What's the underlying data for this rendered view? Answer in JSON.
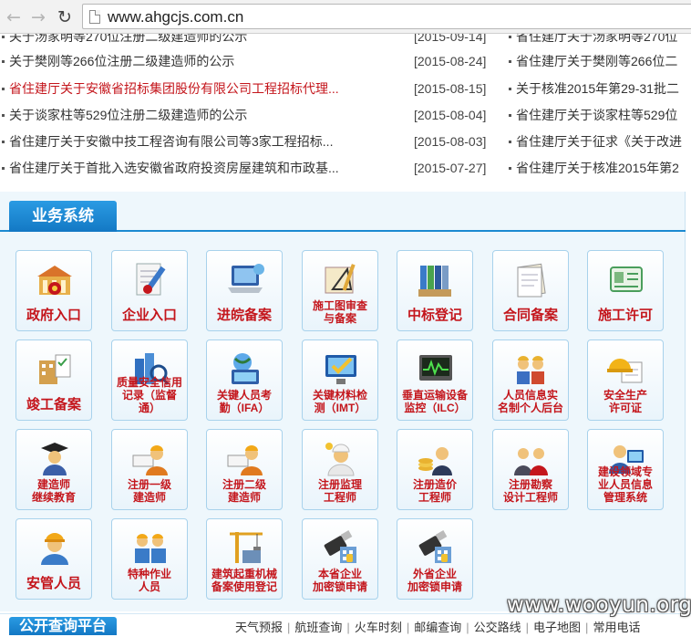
{
  "browser": {
    "url": "www.ahgcjs.com.cn",
    "back_icon": "arrow-left-icon",
    "forward_icon": "arrow-right-icon",
    "reload_icon": "reload-icon"
  },
  "news": {
    "rows": [
      {
        "title": "关于汤家明等270位注册二级建造师的公示",
        "date": "[2015-09-14]",
        "right": "省住建厅关于汤家明等270位"
      },
      {
        "title": "关于樊刚等266位注册二级建造师的公示",
        "date": "[2015-08-24]",
        "right": "省住建厅关于樊刚等266位二"
      },
      {
        "title": "省住建厅关于安徽省招标集团股份有限公司工程招标代理...",
        "date": "[2015-08-15]",
        "right": "关于核准2015年第29-31批二"
      },
      {
        "title": "关于谈家柱等529位注册二级建造师的公示",
        "date": "[2015-08-04]",
        "right": "省住建厅关于谈家柱等529位"
      },
      {
        "title": "省住建厅关于安徽中技工程咨询有限公司等3家工程招标...",
        "date": "[2015-08-03]",
        "right": "省住建厅关于征求《关于改进"
      },
      {
        "title": "省住建厅关于首批入选安徽省政府投资房屋建筑和市政基...",
        "date": "[2015-07-27]",
        "right": "省住建厅关于核准2015年第2"
      }
    ]
  },
  "business": {
    "title": "业务系统",
    "tiles": [
      {
        "lines": [
          "政府入口"
        ],
        "icon": "government-building-icon"
      },
      {
        "lines": [
          "企业入口"
        ],
        "icon": "document-pen-icon"
      },
      {
        "lines": [
          "进皖备案"
        ],
        "icon": "laptop-icon"
      },
      {
        "lines": [
          "施工图审查",
          "与备案"
        ],
        "icon": "blueprint-tools-icon"
      },
      {
        "lines": [
          "中标登记"
        ],
        "icon": "binders-icon"
      },
      {
        "lines": [
          "合同备案"
        ],
        "icon": "contract-papers-icon"
      },
      {
        "lines": [
          "施工许可"
        ],
        "icon": "id-card-icon"
      },
      {
        "lines": [
          "竣工备案"
        ],
        "icon": "building-checklist-icon"
      },
      {
        "lines": [
          "质量安全信用",
          "记录（监督通）"
        ],
        "icon": "buildings-magnifier-icon"
      },
      {
        "lines": [
          "关键人员考",
          "勤（IFA）"
        ],
        "icon": "globe-monitor-icon"
      },
      {
        "lines": [
          "关键材料检",
          "测（IMT）"
        ],
        "icon": "monitor-check-icon"
      },
      {
        "lines": [
          "垂直运输设备",
          "监控（ILC）"
        ],
        "icon": "monitor-wave-icon"
      },
      {
        "lines": [
          "人员信息实",
          "名制个人后台"
        ],
        "icon": "workers-group-icon"
      },
      {
        "lines": [
          "安全生产",
          "许可证"
        ],
        "icon": "hardhat-certificate-icon"
      },
      {
        "lines": [
          "建造师",
          "继续教育"
        ],
        "icon": "graduate-person-icon"
      },
      {
        "lines": [
          "注册一级",
          "建造师"
        ],
        "icon": "worker-level1-icon"
      },
      {
        "lines": [
          "注册二级",
          "建造师"
        ],
        "icon": "worker-level2-icon"
      },
      {
        "lines": [
          "注册监理",
          "工程师"
        ],
        "icon": "engineer-helmet-icon"
      },
      {
        "lines": [
          "注册造价",
          "工程师"
        ],
        "icon": "engineer-coins-icon"
      },
      {
        "lines": [
          "注册勘察",
          "设计工程师"
        ],
        "icon": "survey-engineers-icon"
      },
      {
        "lines": [
          "建设领域专",
          "业人员信息",
          "管理系统"
        ],
        "icon": "person-computer-icon"
      },
      {
        "lines": [
          "安管人员"
        ],
        "icon": "safety-manager-icon"
      },
      {
        "lines": [
          "特种作业",
          "人员"
        ],
        "icon": "special-workers-icon"
      },
      {
        "lines": [
          "建筑起重机械",
          "备案使用登记"
        ],
        "icon": "tower-crane-icon"
      },
      {
        "lines": [
          "本省企业",
          "加密锁申请"
        ],
        "icon": "usb-key-icon"
      },
      {
        "lines": [
          "外省企业",
          "加密锁申请"
        ],
        "icon": "usb-key-icon"
      }
    ]
  },
  "bottom": {
    "title": "公开查询平台",
    "links": [
      "天气预报",
      "航班查询",
      "火车时刻",
      "邮编查询",
      "公交路线",
      "电子地图",
      "常用电话"
    ]
  },
  "watermark": "www.wooyun.org",
  "colors": {
    "accent": "#1378c4",
    "label_red": "#c4161c",
    "panel_bg": "#eef7fc"
  }
}
